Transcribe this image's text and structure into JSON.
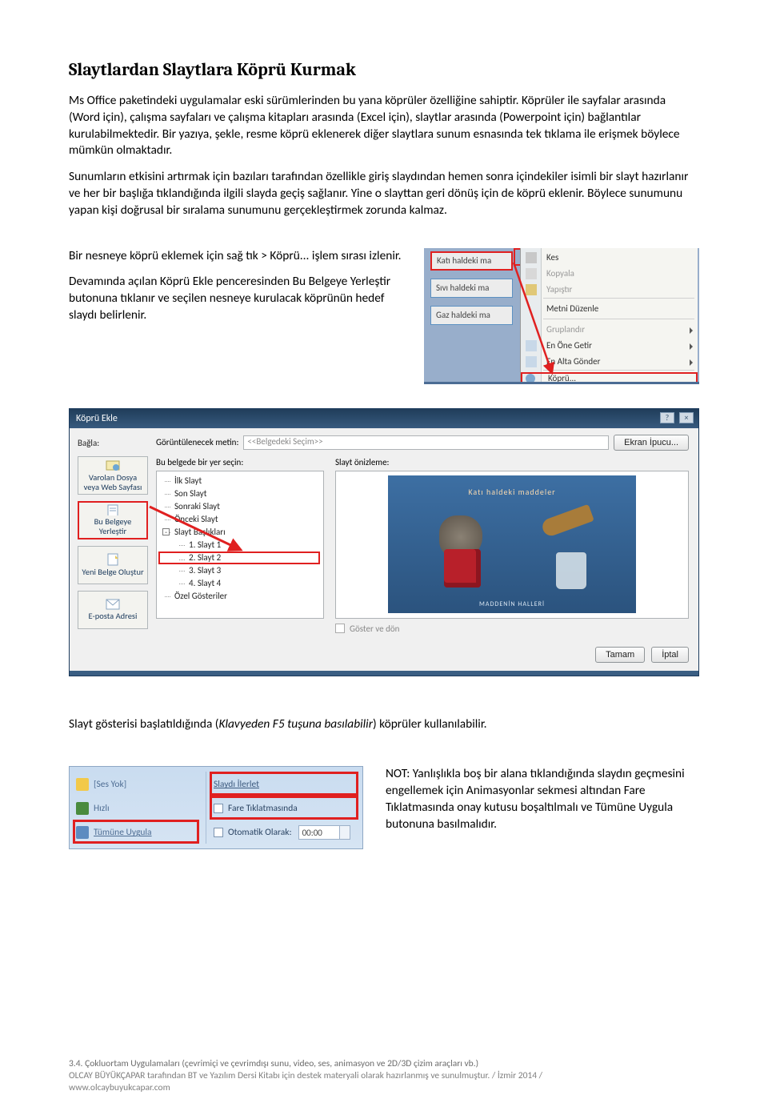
{
  "title": "Slaytlardan Slaytlara Köprü Kurmak",
  "p1": "Ms Office paketindeki uygulamalar eski sürümlerinden bu yana köprüler özelliğine sahiptir. Köprüler ile sayfalar arasında (Word için), çalışma sayfaları ve çalışma kitapları arasında (Excel için), slaytlar arasında (Powerpoint için) bağlantılar kurulabilmektedir. Bir yazıya, şekle, resme köprü eklenerek diğer slaytlara sunum esnasında tek tıklama ile erişmek böylece mümkün olmaktadır.",
  "p2": "Sunumların etkisini artırmak için bazıları tarafından özellikle giriş slaydından hemen sonra içindekiler isimli bir slayt hazırlanır ve her bir başlığa tıklandığında ilgili slayda geçiş sağlanır. Yine o slayttan geri dönüş için de köprü eklenir. Böylece sunumunu yapan kişi doğrusal bir sıralama sunumunu gerçekleştirmek zorunda kalmaz.",
  "p3": "Bir nesneye köprü eklemek için sağ tık > Köprü... işlem sırası izlenir.",
  "p4": "Devamında açılan Köprü Ekle penceresinden Bu Belgeye Yerleştir butonuna tıklanır ve seçilen nesneye kurulacak köprünün hedef slaydı belirlenir.",
  "ctx": {
    "s1": "Katı haldeki ma",
    "s2": "Sıvı haldeki ma",
    "s3": "Gaz haldeki ma",
    "m_cut": "Kes",
    "m_copy": "Kopyala",
    "m_paste": "Yapıştır",
    "m_edit": "Metni Düzenle",
    "m_group": "Gruplandır",
    "m_front": "En Öne Getir",
    "m_back": "En Alta Gönder",
    "m_link": "Köprü..."
  },
  "dlg": {
    "title": "Köprü Ekle",
    "connect_label": "Bağla:",
    "display_label": "Görüntülenecek metin:",
    "display_value": "<<Belgedeki Seçim>>",
    "tip_btn": "Ekran İpucu...",
    "side": {
      "a": "Varolan Dosya veya Web Sayfası",
      "b": "Bu Belgeye Yerleştir",
      "c": "Yeni Belge Oluştur",
      "d": "E-posta Adresi"
    },
    "tree_label": "Bu belgede bir yer seçin:",
    "prev_label": "Slayt önizleme:",
    "tree": {
      "t1": "İlk Slayt",
      "t2": "Son Slayt",
      "t3": "Sonraki Slayt",
      "t4": "Önceki Slayt",
      "t5": "Slayt Başlıkları",
      "t6": "1. Slayt 1",
      "t7": "2. Slayt 2",
      "t8": "3. Slayt 3",
      "t9": "4. Slayt 4",
      "t10": "Özel Gösteriler"
    },
    "slide_title": "Katı haldeki maddeler",
    "slide_foot": "MADDENİN HALLERİ",
    "showreturn": "Göster ve dön",
    "ok": "Tamam",
    "cancel": "İptal"
  },
  "p5_pre": "Slayt gösterisi başlatıldığında (",
  "p5_em": "Klavyeden F5 tuşuna basılabilir",
  "p5_post": ") köprüler kullanılabilir.",
  "anim": {
    "nosound": "[Ses Yok]",
    "fast": "Hızlı",
    "applyall": "Tümüne Uygula",
    "slide_adv": "Slaydı İlerlet",
    "mouseclick": "Fare Tıklatmasında",
    "auto": "Otomatik Olarak:",
    "time": "00:00"
  },
  "note": "NOT: Yanlışlıkla boş bir alana tıklandığında slaydın geçmesini engellemek için Animasyonlar sekmesi altından Fare Tıklatmasında onay kutusu boşaltılmalı ve Tümüne Uygula butonuna basılmalıdır.",
  "footer": {
    "l1": "3.4. Çokluortam Uygulamaları (çevrimiçi ve çevrimdışı sunu, video, ses, animasyon ve 2D/3D çizim araçları vb.)",
    "l2": "OLCAY BÜYÜKÇAPAR tarafından BT ve Yazılım Dersi Kitabı için destek materyali olarak hazırlanmış ve sunulmuştur.  /  İzmir 2014  /",
    "l3": "www.olcaybuyukcapar.com"
  }
}
